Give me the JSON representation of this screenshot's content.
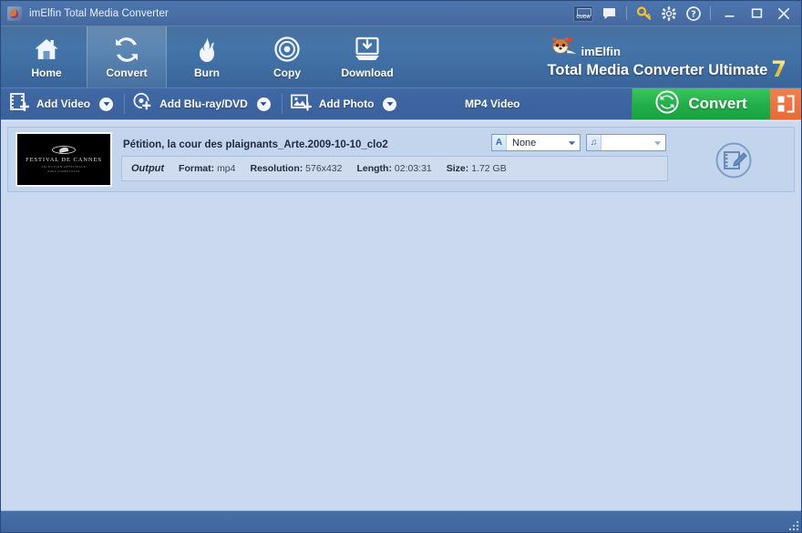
{
  "window": {
    "title": "imElfin Total Media Converter",
    "app_icon": "app-icon",
    "controls": {
      "cuda_label": "CUDA",
      "minimize": "—",
      "maximize": "□",
      "close": "✕"
    }
  },
  "ribbon": {
    "tabs": [
      {
        "label": "Home",
        "icon": "home-icon",
        "active": false
      },
      {
        "label": "Convert",
        "icon": "convert-icon",
        "active": true
      },
      {
        "label": "Burn",
        "icon": "flame-icon",
        "active": false
      },
      {
        "label": "Copy",
        "icon": "disc-icon",
        "active": false
      },
      {
        "label": "Download",
        "icon": "download-icon",
        "active": false
      }
    ],
    "brand": {
      "name": "imElfin",
      "product": "Total Media Converter Ultimate",
      "version": "7"
    }
  },
  "actionbar": {
    "add_video": "Add Video",
    "add_bluray": "Add Blu-ray/DVD",
    "add_photo": "Add Photo",
    "format_label": "MP4 Video",
    "convert_label": "Convert"
  },
  "file": {
    "name": "Pétition, la cour des plaignants_Arte.2009-10-10_clo2",
    "thumbnail": {
      "line1": "FESTIVAL DE CANNES",
      "line2": "SELECTION OFFICIELLE",
      "line3": "HORS COMPETITION"
    },
    "meta": {
      "output_label": "Output",
      "format_key": "Format:",
      "format_value": "mp4",
      "resolution_key": "Resolution:",
      "resolution_value": "576x432",
      "length_key": "Length:",
      "length_value": "02:03:31",
      "size_key": "Size:",
      "size_value": "1.72 GB"
    },
    "subtitle_select": {
      "badge": "A",
      "value": "None"
    },
    "audio_select": {
      "badge": "♫",
      "value": ""
    }
  },
  "colors": {
    "titlebar": "#4a70a8",
    "ribbon": "#4375a9",
    "actionbar": "#3d649f",
    "content_bg": "#cbd9f0",
    "convert_green": "#21ae49",
    "panel_orange": "#e66a38",
    "accent_yellow": "#f4c430"
  }
}
